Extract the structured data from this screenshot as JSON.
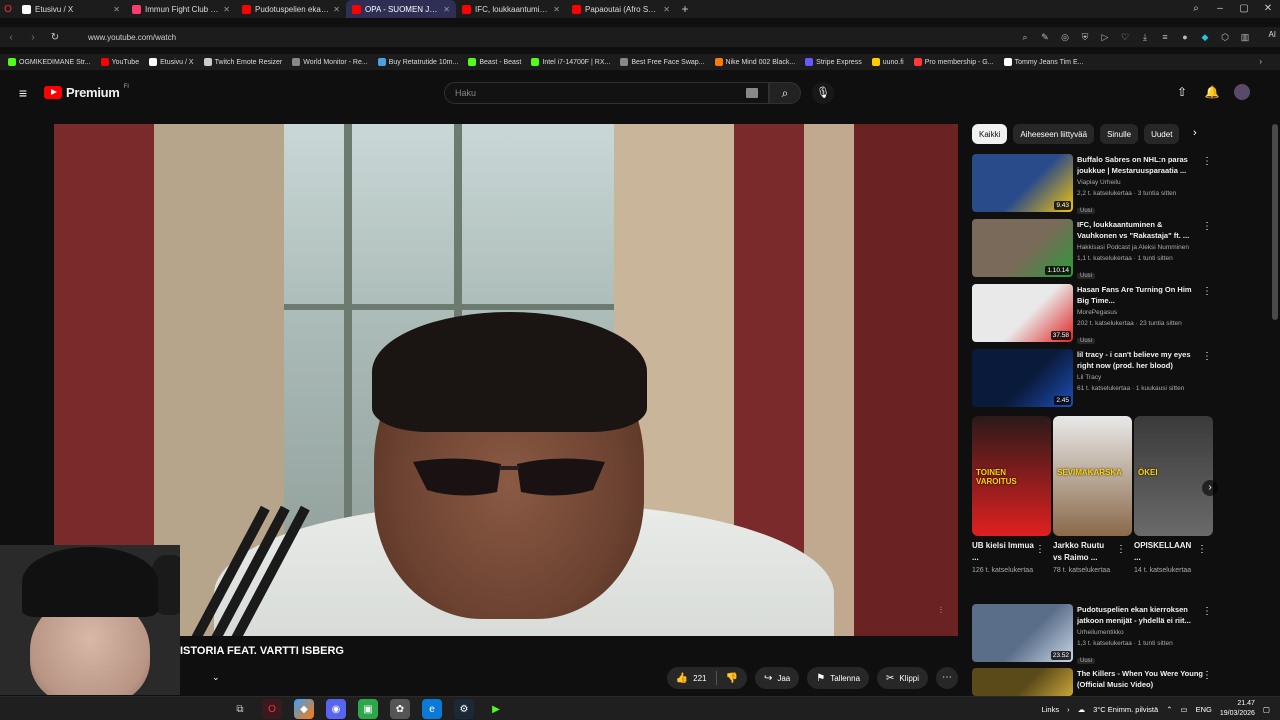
{
  "browser": {
    "tabs": [
      {
        "title": "Etusivu / X",
        "color": "#ffffff",
        "active": false
      },
      {
        "title": "Immun Fight Club | Ruutu",
        "color": "#ff3a6e",
        "active": false
      },
      {
        "title": "Pudotuspelien ekan kierr...",
        "color": "#ff0000",
        "active": false
      },
      {
        "title": "OPA - SUOMEN JENGI",
        "color": "#ff0000",
        "active": true
      },
      {
        "title": "IFC, loukkaantuminen &...",
        "color": "#ff0000",
        "active": false
      },
      {
        "title": "Papaoutai (Afro Soul) - Yo",
        "color": "#ff0000",
        "active": false
      }
    ],
    "url": "www.youtube.com/watch",
    "ai_label": "AI",
    "bookmarks": [
      {
        "label": "OGMIKEDIMANE Str...",
        "color": "#53fc18"
      },
      {
        "label": "YouTube",
        "color": "#ff0000"
      },
      {
        "label": "Etusivu / X",
        "color": "#ffffff"
      },
      {
        "label": "Twitch Emote Resizer",
        "color": "#cccccc"
      },
      {
        "label": "World Monitor - Re...",
        "color": "#888888"
      },
      {
        "label": "Buy Retatrutide 10m...",
        "color": "#4aa3df"
      },
      {
        "label": "Beast - Beast",
        "color": "#53fc18"
      },
      {
        "label": "Intel i7-14700F | RX...",
        "color": "#53fc18"
      },
      {
        "label": "Best Free Face Swap...",
        "color": "#888888"
      },
      {
        "label": "Nike Mind 002 Black...",
        "color": "#ff7a00"
      },
      {
        "label": "Stripe Express",
        "color": "#635bff"
      },
      {
        "label": "uuno.fi",
        "color": "#ffcc00"
      },
      {
        "label": "Pro membership - G...",
        "color": "#ff3a3a"
      },
      {
        "label": "Tommy Jeans Tim E...",
        "color": "#ffffff"
      }
    ]
  },
  "youtube": {
    "logo_text": "Premium",
    "logo_sup": "FI",
    "search_placeholder": "Haku",
    "video_title": "ISTORIA FEAT. VARTTI ISBERG",
    "likes": "221",
    "share_label": "Jaa",
    "save_label": "Tallenna",
    "clip_label": "Klippi",
    "chips": [
      "Kaikki",
      "Aiheeseen liittyvää",
      "Sinulle",
      "Uudet"
    ],
    "recommendations": [
      {
        "title": "Buffalo Sabres on NHL:n paras joukkue | Mestaruusparaatia ...",
        "channel": "Viaplay Urheilu",
        "meta": "2,2 t. katselukertaa · 3 tuntia sitten",
        "badge": "Uusi",
        "duration": "9.43",
        "thumb_a": "#2a4b8a",
        "thumb_b": "#f1c40f"
      },
      {
        "title": "IFC, loukkaantuminen & Vauhkonen vs \"Rakastaja\" ft. ...",
        "channel": "Hakkisasi Podcast ja Aleksi Numminen",
        "meta": "1,1 t. katselukertaa · 1 tunti sitten",
        "badge": "Uusi",
        "duration": "1.10.14",
        "thumb_a": "#7a6a5a",
        "thumb_b": "#2a9a3a"
      },
      {
        "title": "Hasan Fans Are Turning On Him Big Time...",
        "channel": "MorePegasus",
        "meta": "202 t. katselukertaa · 23 tuntia sitten",
        "badge": "Uusi",
        "duration": "37.58",
        "thumb_a": "#e9e9e9",
        "thumb_b": "#e02020"
      },
      {
        "title": "lil tracy - i can't believe my eyes right now (prod. her blood)",
        "channel": "Lil Tracy",
        "meta": "61 t. katselukertaa · 1 kuukausi sitten",
        "badge": "",
        "duration": "2.45",
        "thumb_a": "#0a1a3a",
        "thumb_b": "#1e4fb8"
      },
      {
        "title": "Pudotuspelien ekan kierroksen jatkoon menijät - yhdellä ei riit...",
        "channel": "Urheilumentikko",
        "meta": "1,3 t. katselukertaa · 1 tunti sitten",
        "badge": "Uusi",
        "duration": "23.52",
        "thumb_a": "#5a6e8a",
        "thumb_b": "#c9d6e6"
      },
      {
        "title": "The Killers - When You Were Young (Official Music Video)",
        "channel": "",
        "meta": "",
        "badge": "",
        "duration": "",
        "thumb_a": "#5a4a1a",
        "thumb_b": "#c9a43a"
      }
    ],
    "shorts": [
      {
        "title": "UB kielsi Immua ...",
        "views": "126 t. katselukertaa",
        "overlay": "TOINEN VAROITUS",
        "thumb_a": "#2a1a1a",
        "thumb_b": "#e02020"
      },
      {
        "title": "Jarkko Ruutu vs Raimo ...",
        "views": "78 t. katselukertaa",
        "overlay": "SEVIMAKARSKA",
        "thumb_a": "#e9e9e9",
        "thumb_b": "#8a6a4a"
      },
      {
        "title": "OPISKELLAAN ...",
        "views": "14 t. katselukertaa",
        "overlay": "ÖKEI",
        "thumb_a": "#3a3a3a",
        "thumb_b": "#6a6a6a"
      }
    ]
  },
  "taskbar": {
    "links_label": "Links",
    "weather": "3°C  Enimm. pilvistä",
    "lang": "ENG",
    "time": "21.47",
    "date": "19/03/2026"
  }
}
